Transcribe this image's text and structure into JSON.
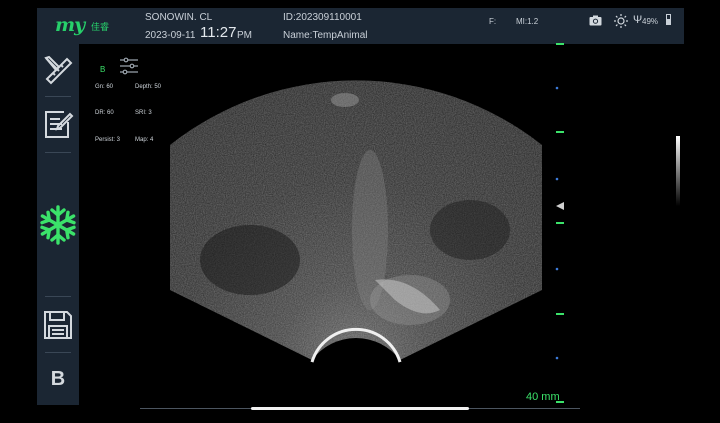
{
  "header": {
    "logo_text": "my",
    "logo_sub": "佳睿",
    "hospital": "SONOWIN. CL",
    "date": "2023-09-11",
    "time": "11:27",
    "ampm": "PM",
    "patient_id": "ID:202309110001",
    "patient_name": "Name:TempAnimal",
    "frequency": "F:",
    "mi": "MI:1.2",
    "usb_symbol": "Ψ",
    "battery": "49%"
  },
  "sidebar": {
    "items": [
      {
        "name": "measure-tools-icon"
      },
      {
        "name": "annotation-icon"
      },
      {
        "name": "freeze-icon"
      },
      {
        "name": "save-icon"
      },
      {
        "name": "mode-b-button",
        "label": "B"
      }
    ]
  },
  "imaging": {
    "mode": "B",
    "params": {
      "gain": "Gn: 60",
      "depth": "Depth: 50",
      "dr": "DR: 60",
      "sri": "SRI: 3",
      "persist": "Persist: 3",
      "map": "Map: 4"
    },
    "scale_label": "40 mm"
  },
  "colors": {
    "accent": "#3be26a",
    "panel": "#1b2633"
  }
}
